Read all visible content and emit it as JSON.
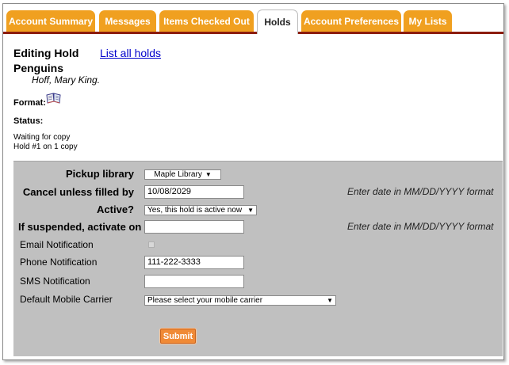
{
  "tabs": [
    {
      "label": "Account Summary",
      "active": false
    },
    {
      "label": "Messages",
      "active": false
    },
    {
      "label": "Items Checked Out",
      "active": false
    },
    {
      "label": "Holds",
      "active": true
    },
    {
      "label": "Account Preferences",
      "active": false
    },
    {
      "label": "My Lists",
      "active": false
    }
  ],
  "header": {
    "title": "Editing Hold",
    "list_link": "List all holds"
  },
  "item": {
    "title": "Penguins",
    "author": "Hoff, Mary King.",
    "format_label": "Format:",
    "format_icon": "book-icon",
    "status_label": "Status:",
    "status_text": "Waiting for copy",
    "hold_position": "Hold #1 on 1 copy"
  },
  "form": {
    "pickup_label": "Pickup library",
    "pickup_value": "Maple Library",
    "cancel_label": "Cancel unless filled by",
    "cancel_value": "10/08/2029",
    "cancel_hint": "Enter date in MM/DD/YYYY format",
    "active_label": "Active?",
    "active_value": "Yes, this hold is active now",
    "suspend_label": "If suspended, activate on",
    "suspend_value": "",
    "suspend_hint": "Enter date in MM/DD/YYYY format",
    "email_label": "Email Notification",
    "email_checked": false,
    "phone_label": "Phone Notification",
    "phone_value": "111-222-3333",
    "sms_label": "SMS Notification",
    "sms_value": "",
    "carrier_label": "Default Mobile Carrier",
    "carrier_value": "Please select your mobile carrier",
    "submit_label": "Submit"
  },
  "colors": {
    "tab_orange": "#f0a020",
    "tab_bar_border": "#8c1d0f",
    "form_background": "#c0c0c0",
    "submit_orange": "#f08a36",
    "link_blue": "#0000cc"
  }
}
